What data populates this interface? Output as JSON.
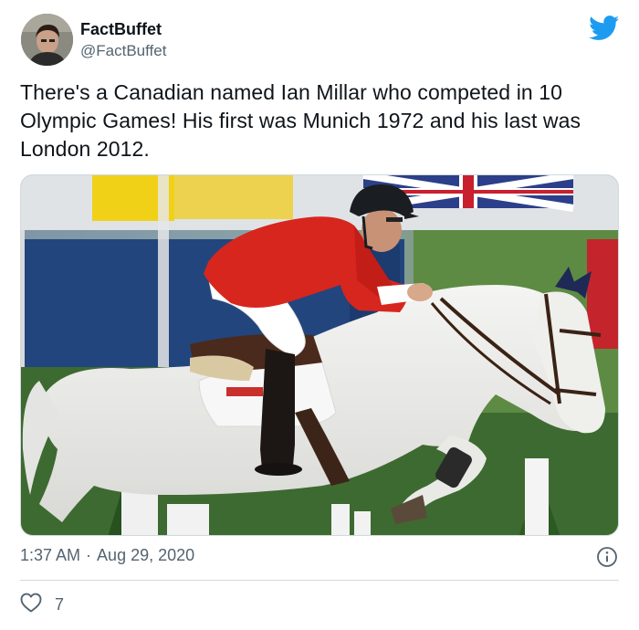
{
  "tweet": {
    "display_name": "FactBuffet",
    "handle": "@FactBuffet",
    "text": "There's a Canadian named Ian Millar who competed in 10 Olympic Games! His first was Munich 1972 and his last was London 2012.",
    "time": "1:37 AM",
    "separator": "·",
    "date": "Aug 29, 2020",
    "like_count": "7"
  },
  "icons": {
    "brand": "twitter-bird-icon",
    "info": "info-icon",
    "like": "heart-icon"
  },
  "colors": {
    "twitter_blue": "#1d9bf0",
    "text_primary": "#0f1419",
    "text_secondary": "#536471",
    "divider": "#cfd9de",
    "rider_jacket": "#d7261e"
  }
}
